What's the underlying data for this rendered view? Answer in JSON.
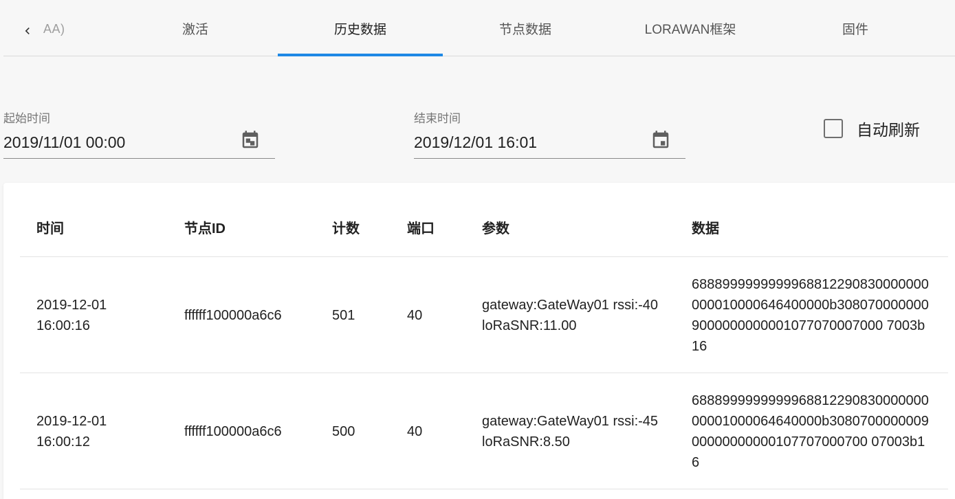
{
  "tabs": {
    "partial_label": "AA)",
    "items": [
      {
        "label": "激活"
      },
      {
        "label": "历史数据"
      },
      {
        "label": "节点数据"
      },
      {
        "label": "LORAWAN框架"
      },
      {
        "label": "固件"
      }
    ],
    "active_index": 1,
    "accent_color": "#1e88e5"
  },
  "filters": {
    "start": {
      "label": "起始时间",
      "value": "2019/11/01 00:00"
    },
    "end": {
      "label": "结束时间",
      "value": "2019/12/01 16:01"
    },
    "auto_refresh": {
      "label": "自动刷新",
      "checked": false
    }
  },
  "table": {
    "headers": [
      "时间",
      "节点ID",
      "计数",
      "端口",
      "参数",
      "数据"
    ],
    "rows": [
      {
        "time": "2019-12-01 16:00:16",
        "node_id": "ffffff100000a6c6",
        "count": "501",
        "port": "40",
        "params": "gateway:GateWay01 rssi:-40 loRaSNR:11.00",
        "data": "6888999999999968812290830000000000010000646400000b3080700000009000000000001077070007000 7003b16"
      },
      {
        "time": "2019-12-01 16:00:12",
        "node_id": "ffffff100000a6c6",
        "count": "500",
        "port": "40",
        "params": "gateway:GateWay01 rssi:-45 loRaSNR:8.50",
        "data": "688899999999996881229083000000000001000064640000b308070000000900000000000107707000700 07003b16"
      }
    ]
  },
  "icons": {
    "back": "chevron-left-icon",
    "calendar": "calendar-icon",
    "checkbox": "checkbox-unchecked-icon"
  }
}
